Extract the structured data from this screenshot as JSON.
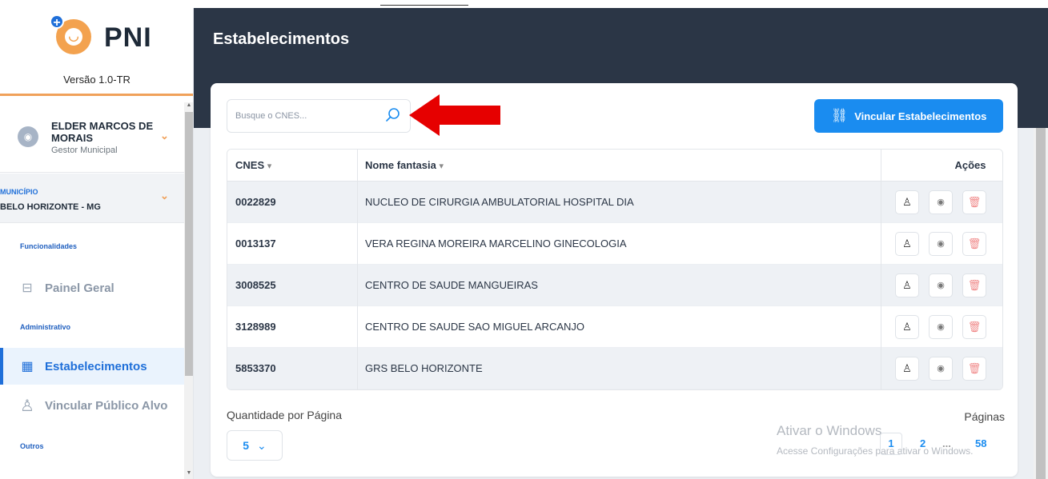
{
  "app": {
    "logo_text": "PNI",
    "version": "Versão 1.0-TR"
  },
  "user": {
    "name": "ELDER MARCOS DE MORAIS",
    "role": "Gestor Municipal"
  },
  "municipio": {
    "label": "MUNICÍPIO",
    "value": "BELO HORIZONTE - MG"
  },
  "sidebar": {
    "sections": [
      {
        "title": "Funcionalidades"
      },
      {
        "title": "Administrativo"
      },
      {
        "title": "Outros"
      }
    ],
    "items": [
      {
        "label": "Painel Geral",
        "icon": "presentation-board-icon"
      },
      {
        "label": "Estabelecimentos",
        "icon": "building-icon",
        "active": true
      },
      {
        "label": "Vincular Público Alvo",
        "icon": "user-icon"
      }
    ]
  },
  "header": {
    "title": "Estabelecimentos"
  },
  "search": {
    "placeholder": "Busque o CNES...",
    "value": ""
  },
  "actions": {
    "vincular_label": "Vincular Estabelecimentos",
    "vincular_icon": "link-icon"
  },
  "table": {
    "columns": [
      "CNES",
      "Nome fantasia",
      "Ações"
    ],
    "sort_indicator": "▾",
    "rows": [
      {
        "cnes": "0022829",
        "nome": "NUCLEO DE CIRURGIA AMBULATORIAL HOSPITAL DIA"
      },
      {
        "cnes": "0013137",
        "nome": "VERA REGINA MOREIRA MARCELINO GINECOLOGIA"
      },
      {
        "cnes": "3008525",
        "nome": "CENTRO DE SAUDE MANGUEIRAS"
      },
      {
        "cnes": "3128989",
        "nome": "CENTRO DE SAUDE SAO MIGUEL ARCANJO"
      },
      {
        "cnes": "5853370",
        "nome": "GRS BELO HORIZONTE"
      }
    ],
    "row_action_icons": [
      "user-link-icon",
      "eye-icon",
      "trash-icon"
    ]
  },
  "pagination": {
    "qty_label": "Quantidade por Página",
    "qty_value": "5",
    "pages_label": "Páginas",
    "pages": [
      "1",
      "2",
      "58"
    ],
    "current_page": "1",
    "ellipsis": "..."
  },
  "watermark": {
    "line1": "Ativar o Windows",
    "line2": "Acesse Configurações para ativar o Windows."
  },
  "colors": {
    "header_bg": "#2b3646",
    "accent": "#1a8cf0",
    "logo_orange": "#f3a24f",
    "annotation_arrow": "#e60000"
  }
}
